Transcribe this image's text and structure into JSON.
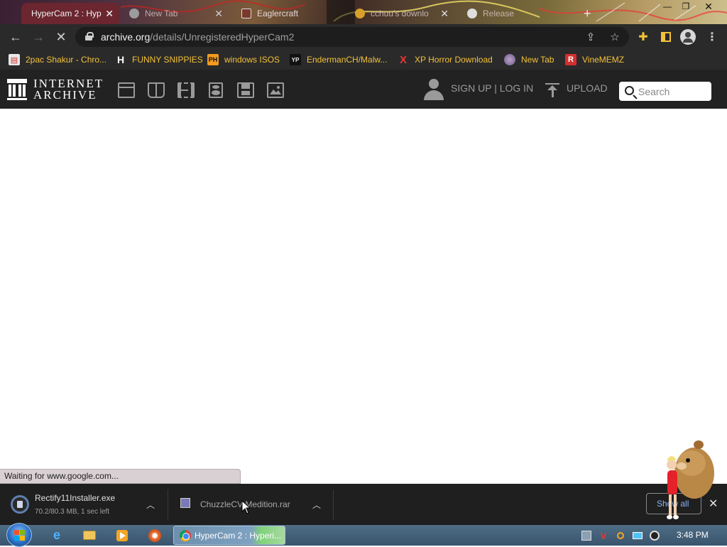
{
  "tabs": [
    {
      "title": "HyperCam 2 : Hyp",
      "active": true
    },
    {
      "title": "New Tab",
      "active": false
    },
    {
      "title": "Eaglercraft",
      "active": false
    },
    {
      "title": "cchuu's downlo",
      "active": false
    },
    {
      "title": "Release",
      "active": false
    }
  ],
  "address_bar": {
    "host": "archive.org",
    "path": "/details/UnregisteredHyperCam2"
  },
  "bookmarks": [
    {
      "label": "2pac Shakur - Chro...",
      "icon": "store-icon"
    },
    {
      "label": "FUNNY SNIPPIES",
      "icon": "h-logo-icon",
      "glyph": "H"
    },
    {
      "label": "windows ISOS",
      "icon": "ph-logo-icon",
      "glyph": "PH"
    },
    {
      "label": "EndermanCH/Malw...",
      "icon": "yp-logo-icon",
      "glyph": "YP"
    },
    {
      "label": "XP Horror Download",
      "icon": "x-logo-icon",
      "glyph": "X"
    },
    {
      "label": "New Tab",
      "icon": "globe-icon"
    },
    {
      "label": "VineMEMZ",
      "icon": "r-logo-icon",
      "glyph": "R"
    }
  ],
  "archive_header": {
    "wordmark_line1": "INTERNET",
    "wordmark_line2": "ARCHIVE",
    "media_icons": [
      "web-icon",
      "texts-icon",
      "video-icon",
      "audio-icon",
      "software-icon",
      "images-icon"
    ],
    "signup_login": "SIGN UP | LOG IN",
    "upload": "UPLOAD",
    "search_placeholder": "Search"
  },
  "status_text": "Waiting for www.google.com...",
  "downloads": [
    {
      "name": "Rectify11Installer.exe",
      "progress": "70.2/80.3 MB, 1 sec left"
    },
    {
      "name": "ChuzzleCV Medition.rar",
      "progress": ""
    }
  ],
  "downloads_show_all": "Show all",
  "taskbar": {
    "active_window": "HyperCam 2 : Hyperi...",
    "clock": "3:48 PM"
  },
  "colors": {
    "bookmark_text": "#f3c13a",
    "archive_header_bg": "#222222",
    "toolbar_bg": "#2a2a2a",
    "active_tab_bg": "#6b2630"
  }
}
